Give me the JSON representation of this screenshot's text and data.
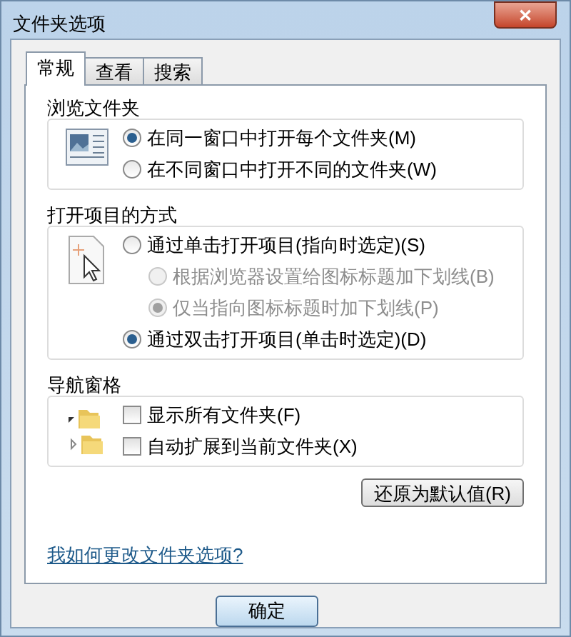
{
  "window": {
    "title": "文件夹选项",
    "close": "✕"
  },
  "tabs": [
    {
      "label": "常规",
      "selected": true
    },
    {
      "label": "查看",
      "selected": false
    },
    {
      "label": "搜索",
      "selected": false
    }
  ],
  "groups": [
    {
      "title": "浏览文件夹",
      "options": [
        {
          "kind": "radio",
          "label": "在同一窗口中打开每个文件夹(M)",
          "selected": true,
          "disabled": false
        },
        {
          "kind": "radio",
          "label": "在不同窗口中打开不同的文件夹(W)",
          "selected": false,
          "disabled": false
        }
      ]
    },
    {
      "title": "打开项目的方式",
      "options": [
        {
          "kind": "radio",
          "label": "通过单击打开项目(指向时选定)(S)",
          "selected": false,
          "disabled": false
        },
        {
          "kind": "subradio",
          "label": "根据浏览器设置给图标标题加下划线(B)",
          "selected": false,
          "disabled": true
        },
        {
          "kind": "subradio",
          "label": "仅当指向图标标题时加下划线(P)",
          "selected": true,
          "disabled": true
        },
        {
          "kind": "radio",
          "label": "通过双击打开项目(单击时选定)(D)",
          "selected": true,
          "disabled": false
        }
      ]
    },
    {
      "title": "导航窗格",
      "options": [
        {
          "kind": "checkbox",
          "label": "显示所有文件夹(F)",
          "checked": false
        },
        {
          "kind": "checkbox",
          "label": "自动扩展到当前文件夹(X)",
          "checked": false
        }
      ]
    }
  ],
  "restore_button": "还原为默认值(R)",
  "help_link": "我如何更改文件夹选项?",
  "ok_button": "确定"
}
